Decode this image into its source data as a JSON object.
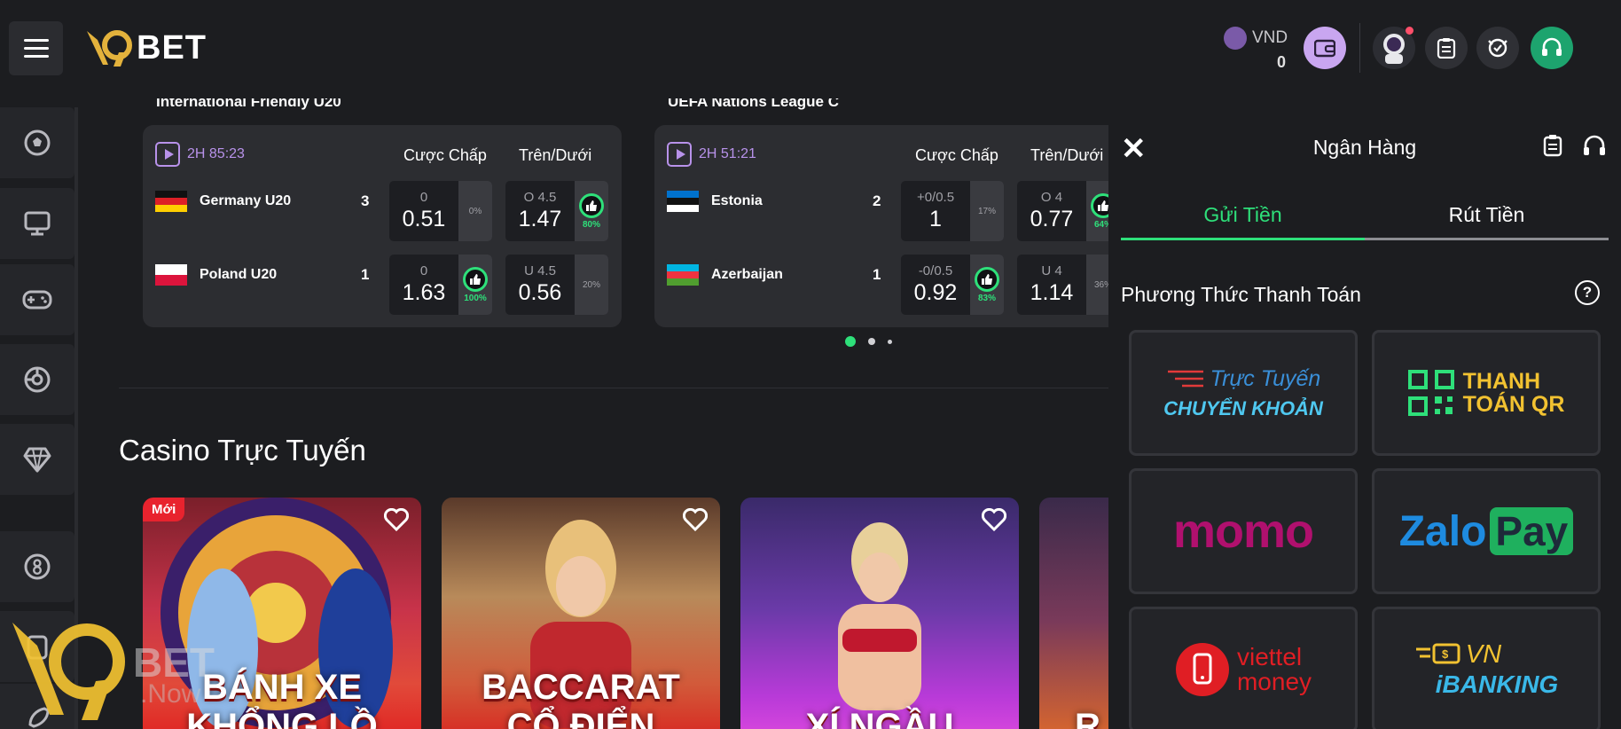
{
  "brand": {
    "logo_text": "BET",
    "logo_mark": "V9"
  },
  "header": {
    "currency": "VND",
    "balance": "0"
  },
  "sidebar": {
    "items": [
      "soccer",
      "monitor",
      "gamepad",
      "esports",
      "diamond",
      "lottery",
      "cards",
      "rocket"
    ]
  },
  "matches": [
    {
      "league": "International Friendly U20",
      "time": "2H 85:23",
      "handicap_label": "Cược Chấp",
      "ou_label": "Trên/Dưới",
      "teams": [
        {
          "name": "Germany U20",
          "score": "3"
        },
        {
          "name": "Poland U20",
          "score": "1"
        }
      ],
      "odds": [
        {
          "line": "0",
          "value": "0.51",
          "pct": "0%"
        },
        {
          "line": "O 4.5",
          "value": "1.47",
          "pct": "80%"
        },
        {
          "line": "0",
          "value": "1.63",
          "pct": "100%"
        },
        {
          "line": "U 4.5",
          "value": "0.56",
          "pct": "20%"
        }
      ]
    },
    {
      "league": "UEFA Nations League C",
      "time": "2H 51:21",
      "handicap_label": "Cược Chấp",
      "ou_label": "Trên/Dưới",
      "teams": [
        {
          "name": "Estonia",
          "score": "2"
        },
        {
          "name": "Azerbaijan",
          "score": "1"
        }
      ],
      "odds": [
        {
          "line": "+0/0.5",
          "value": "1",
          "pct": "17%"
        },
        {
          "line": "O 4",
          "value": "0.77",
          "pct": "64%"
        },
        {
          "line": "-0/0.5",
          "value": "0.92",
          "pct": "83%"
        },
        {
          "line": "U 4",
          "value": "1.14",
          "pct": "36%"
        }
      ]
    }
  ],
  "casino": {
    "title": "Casino Trực Tuyến",
    "badge_new": "Mới",
    "games": [
      {
        "line1": "BÁNH XE",
        "line2": "KHỔNG LỒ"
      },
      {
        "line1": "BACCARAT",
        "line2": "CỔ ĐIỂN"
      },
      {
        "line1": "",
        "line2": "XÍ NGẦU"
      },
      {
        "line1": "",
        "line2": "R"
      }
    ]
  },
  "watermark": {
    "text": "BET",
    "sub": ".Now"
  },
  "panel": {
    "title": "Ngân Hàng",
    "tab_deposit": "Gửi Tiền",
    "tab_withdraw": "Rút Tiền",
    "payment_heading": "Phương Thức Thanh Toán",
    "help": "?",
    "methods": {
      "online_top": "Trực Tuyến",
      "online_bottom": "CHUYỂN KHOẢN",
      "qr_top": "THANH",
      "qr_bottom": "TOÁN QR",
      "momo": "momo",
      "zalo": "Zalo",
      "zalo_pay": "Pay",
      "viettel_top": "viettel",
      "viettel_bottom": "money",
      "vn_top": "VN",
      "vn_bottom": "iBANKING"
    }
  },
  "colors": {
    "accent_green": "#2ee07a",
    "live_purple": "#b892ea",
    "wallet_purple": "#c9a6f0"
  }
}
